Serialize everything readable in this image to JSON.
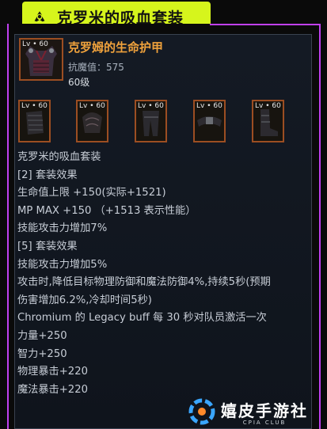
{
  "banner": {
    "title": "克罗米的吸血套装",
    "accent_color": "#d6f51c",
    "icon": "radiation-icon"
  },
  "item": {
    "level_badge": "Lv • 60",
    "name": "克罗姆的生命护甲",
    "stat": "抗魔值：575",
    "level": "60级",
    "name_color": "#f0a23c"
  },
  "set_parts": [
    {
      "level_badge": "Lv • 60",
      "icon": "gauntlet-icon"
    },
    {
      "level_badge": "Lv • 60",
      "icon": "pauldron-icon"
    },
    {
      "level_badge": "Lv • 60",
      "icon": "leggings-icon"
    },
    {
      "level_badge": "Lv • 60",
      "icon": "belt-icon"
    },
    {
      "level_badge": "Lv • 60",
      "icon": "boots-icon"
    }
  ],
  "description": [
    "克罗米的吸血套装",
    "[2] 套装效果",
    "生命值上限 +150(实际+1521)",
    "MP MAX +150 （+1513 表示性能）",
    "技能攻击力增加7%",
    "[5] 套装效果",
    "技能攻击力增加5%",
    "攻击时,降低目标物理防御和魔法防御4%,持续5秒(预期",
    "伤害增加6.2%,冷却时间5秒)",
    "Chromium 的 Legacy buff 每 30 秒对队员激活一次",
    "力量+250",
    "智力+250",
    "物理暴击+220",
    "魔法暴击+220"
  ],
  "watermark": {
    "main": "嬉皮手游社",
    "sub": "CPIA CLUB"
  },
  "frame_color": "#c040f0"
}
